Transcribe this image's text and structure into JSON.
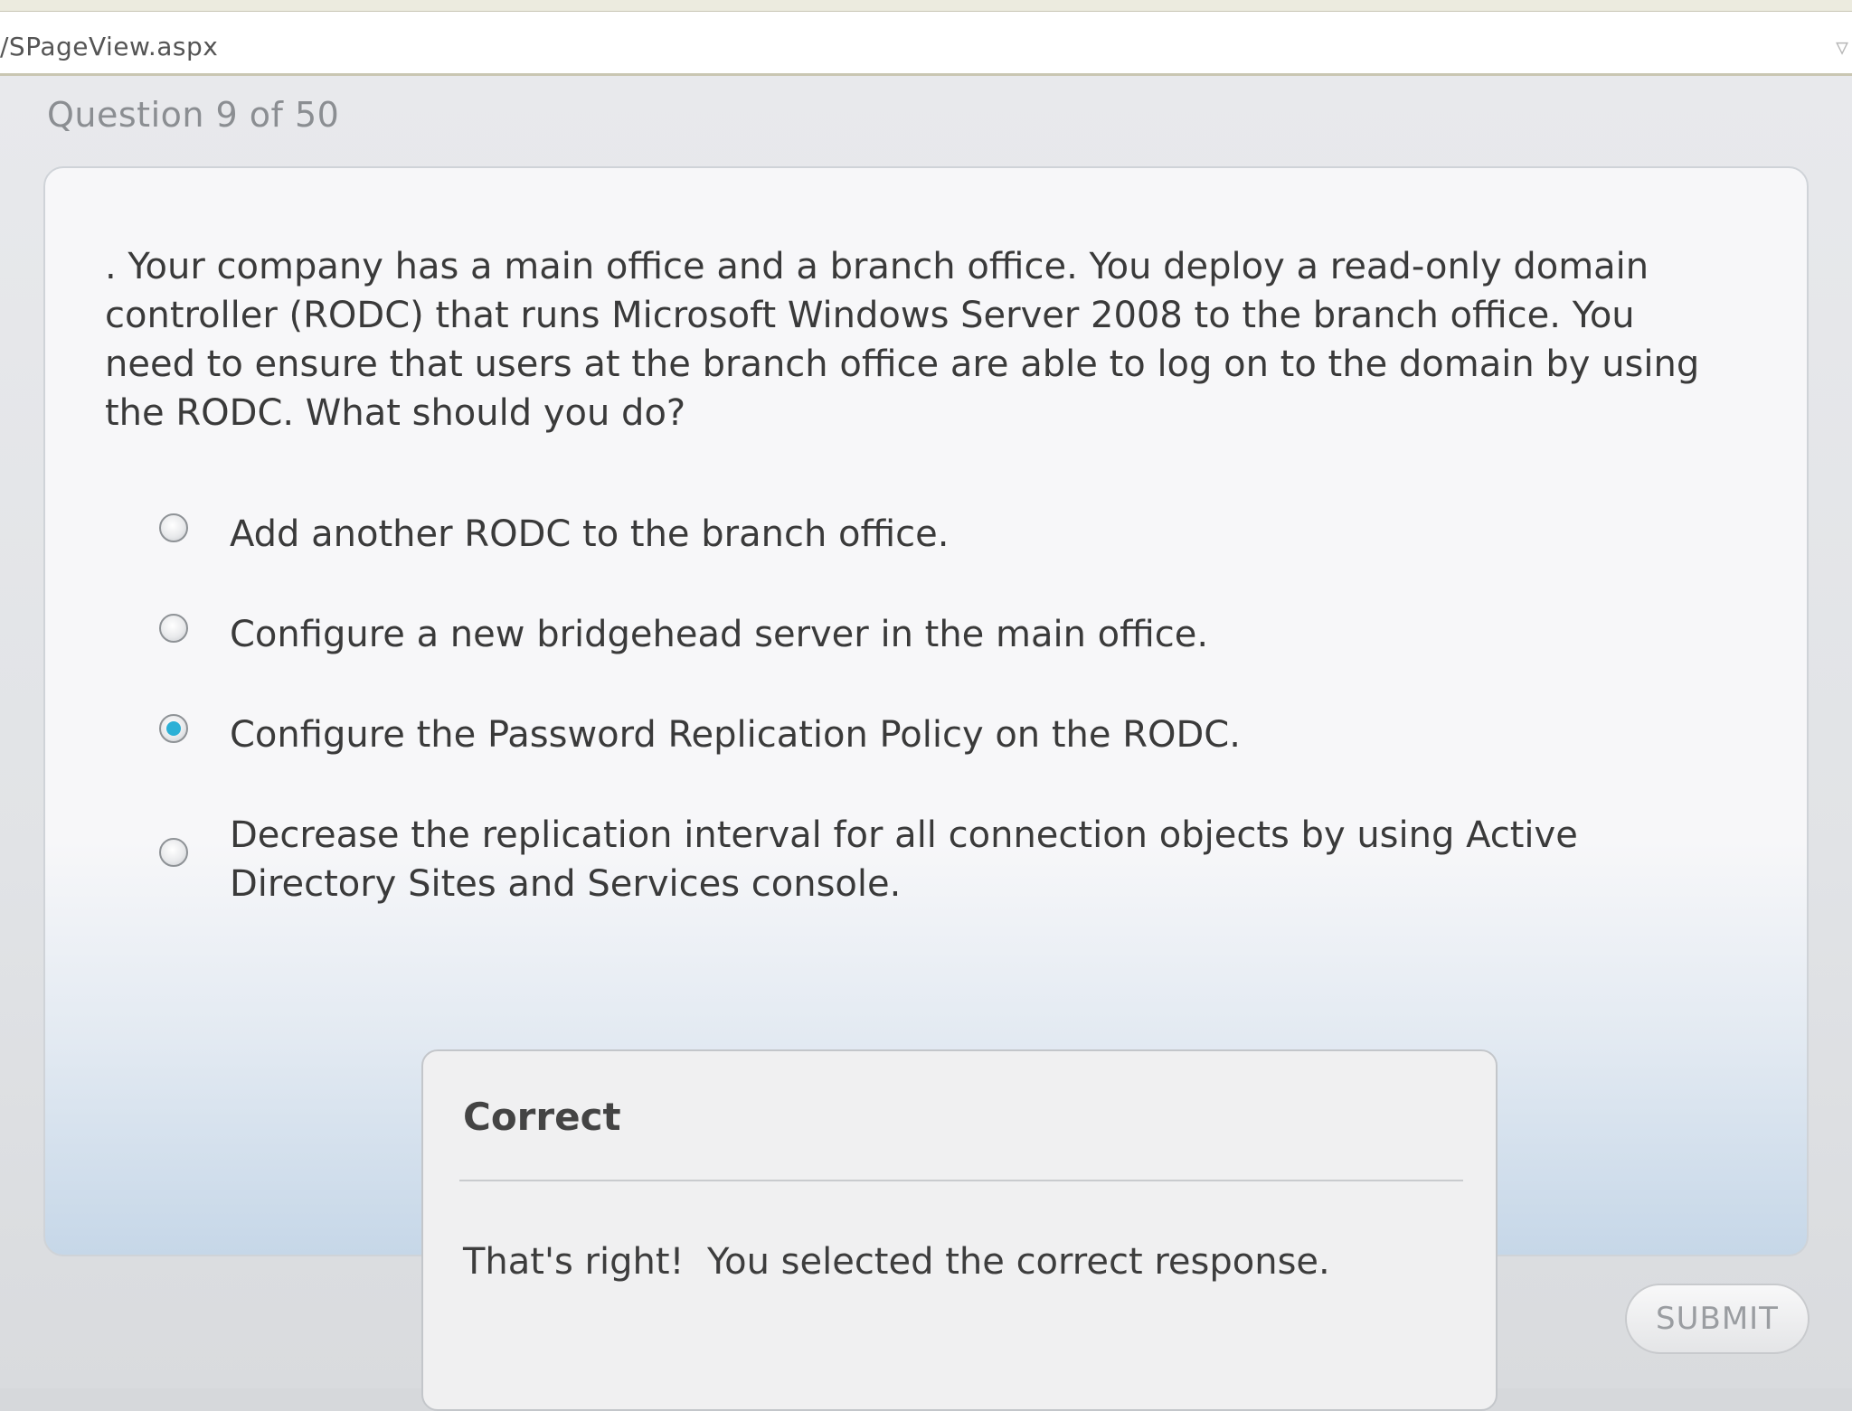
{
  "browser": {
    "address": "/SPageView.aspx"
  },
  "quiz": {
    "counter": "Question 9 of 50",
    "question": ". Your company has a main office and a branch office. You deploy a read-only domain controller (RODC) that runs Microsoft Windows Server 2008 to the branch office. You need to ensure that users at the branch office are able to log on to the domain by using the RODC. What should you do?",
    "options": [
      {
        "label": "Add another RODC to the branch office.",
        "selected": false
      },
      {
        "label": "Configure a new bridgehead server in the main office.",
        "selected": false
      },
      {
        "label": "Configure the Password Replication Policy on the RODC.",
        "selected": true
      },
      {
        "label": "Decrease the replication interval for all connection objects by using Active Directory Sites and Services console.",
        "selected": false
      }
    ],
    "submit_label": "SUBMIT"
  },
  "feedback": {
    "title": "Correct",
    "message": "That's right!  You selected the correct response."
  },
  "colors": {
    "selected_radio": "#2bb0d6",
    "panel_gradient_bottom": "#c6d7e8"
  }
}
